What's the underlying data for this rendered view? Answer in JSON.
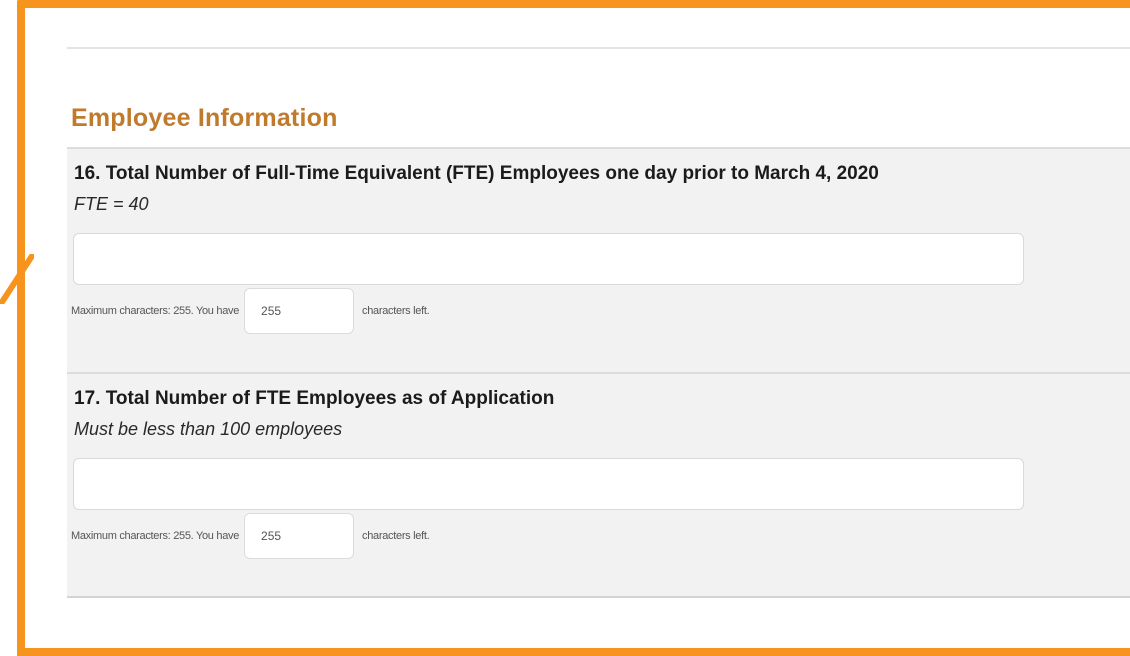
{
  "colors": {
    "callout_border": "#f7941d",
    "section_title": "#c07a2c",
    "panel_background": "#f2f2f2"
  },
  "section": {
    "title": "Employee Information"
  },
  "questions": [
    {
      "label": "16. Total Number of Full-Time Equivalent (FTE) Employees one day prior to March 4, 2020",
      "hint": "FTE = 40",
      "value": "",
      "counter": {
        "prefix": "Maximum characters: 255. You have",
        "remaining": "255",
        "suffix": "characters left."
      }
    },
    {
      "label": "17. Total Number of FTE Employees as of Application",
      "hint": "Must be less than 100 employees",
      "value": "",
      "counter": {
        "prefix": "Maximum characters: 255. You have",
        "remaining": "255",
        "suffix": "characters left."
      }
    }
  ]
}
